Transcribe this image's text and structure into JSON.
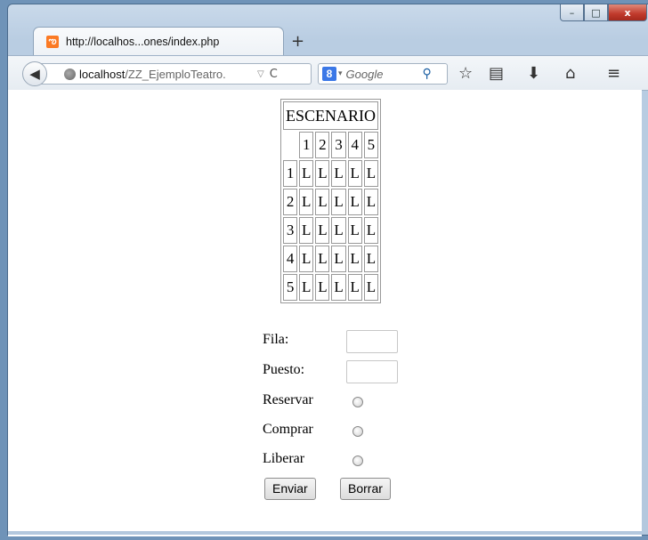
{
  "window": {
    "controls": {
      "minimize": "–",
      "maximize": "□",
      "close": "x"
    }
  },
  "tab": {
    "title": "http://localhos...ones/index.php",
    "new_tab": "+"
  },
  "navbar": {
    "url_host": "localhost",
    "url_path": "/ZZ_EjemploTeatro.",
    "search_placeholder": "Google"
  },
  "stage": {
    "title": "ESCENARIO",
    "col_headers": [
      "1",
      "2",
      "3",
      "4",
      "5"
    ],
    "rows": [
      {
        "label": "1",
        "seats": [
          "L",
          "L",
          "L",
          "L",
          "L"
        ]
      },
      {
        "label": "2",
        "seats": [
          "L",
          "L",
          "L",
          "L",
          "L"
        ]
      },
      {
        "label": "3",
        "seats": [
          "L",
          "L",
          "L",
          "L",
          "L"
        ]
      },
      {
        "label": "4",
        "seats": [
          "L",
          "L",
          "L",
          "L",
          "L"
        ]
      },
      {
        "label": "5",
        "seats": [
          "L",
          "L",
          "L",
          "L",
          "L"
        ]
      }
    ]
  },
  "form": {
    "fila_label": "Fila:",
    "fila_value": "",
    "puesto_label": "Puesto:",
    "puesto_value": "",
    "options": [
      "Reservar",
      "Comprar",
      "Liberar"
    ],
    "submit_label": "Enviar",
    "reset_label": "Borrar"
  }
}
